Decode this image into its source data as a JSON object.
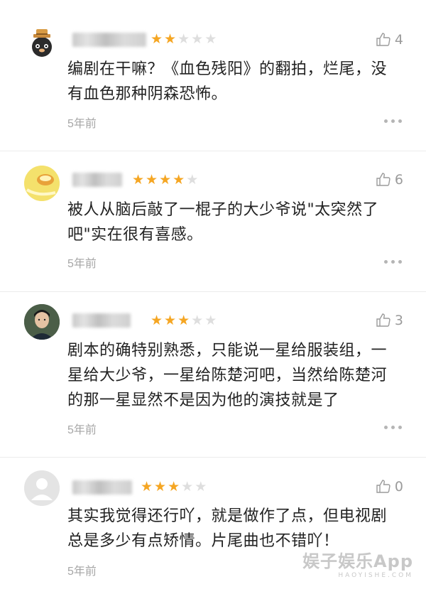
{
  "reviews": [
    {
      "avatar": "cat-with-hat-avatar",
      "rating": 2,
      "likes": "4",
      "content": "编剧在干嘛？《血色残阳》的翻拍，烂尾，没有血色那种阴森恐怖。",
      "time": "5年前"
    },
    {
      "avatar": "yellow-duck-avatar",
      "rating": 4,
      "likes": "6",
      "content": "被人从脑后敲了一棍子的大少爷说\"太突然了吧\"实在很有喜感。",
      "time": "5年前"
    },
    {
      "avatar": "young-man-photo-avatar",
      "rating": 3,
      "likes": "3",
      "content": "剧本的确特别熟悉，只能说一星给服装组，一星给大少爷，一星给陈楚河吧，当然给陈楚河的那一星显然不是因为他的演技就是了",
      "time": "5年前"
    },
    {
      "avatar": "default-user-avatar",
      "rating": 3,
      "likes": "0",
      "content": "其实我觉得还行吖，就是做作了点，但电视剧总是多少有点矫情。片尾曲也不错吖！",
      "time": "5年前"
    }
  ],
  "watermark": {
    "main": "娱子娱乐App",
    "sub": "HAOYISHE.COM"
  },
  "colors": {
    "star_on": "#f5a623",
    "star_off": "#dedede",
    "meta_gray": "#a6a6a6"
  }
}
